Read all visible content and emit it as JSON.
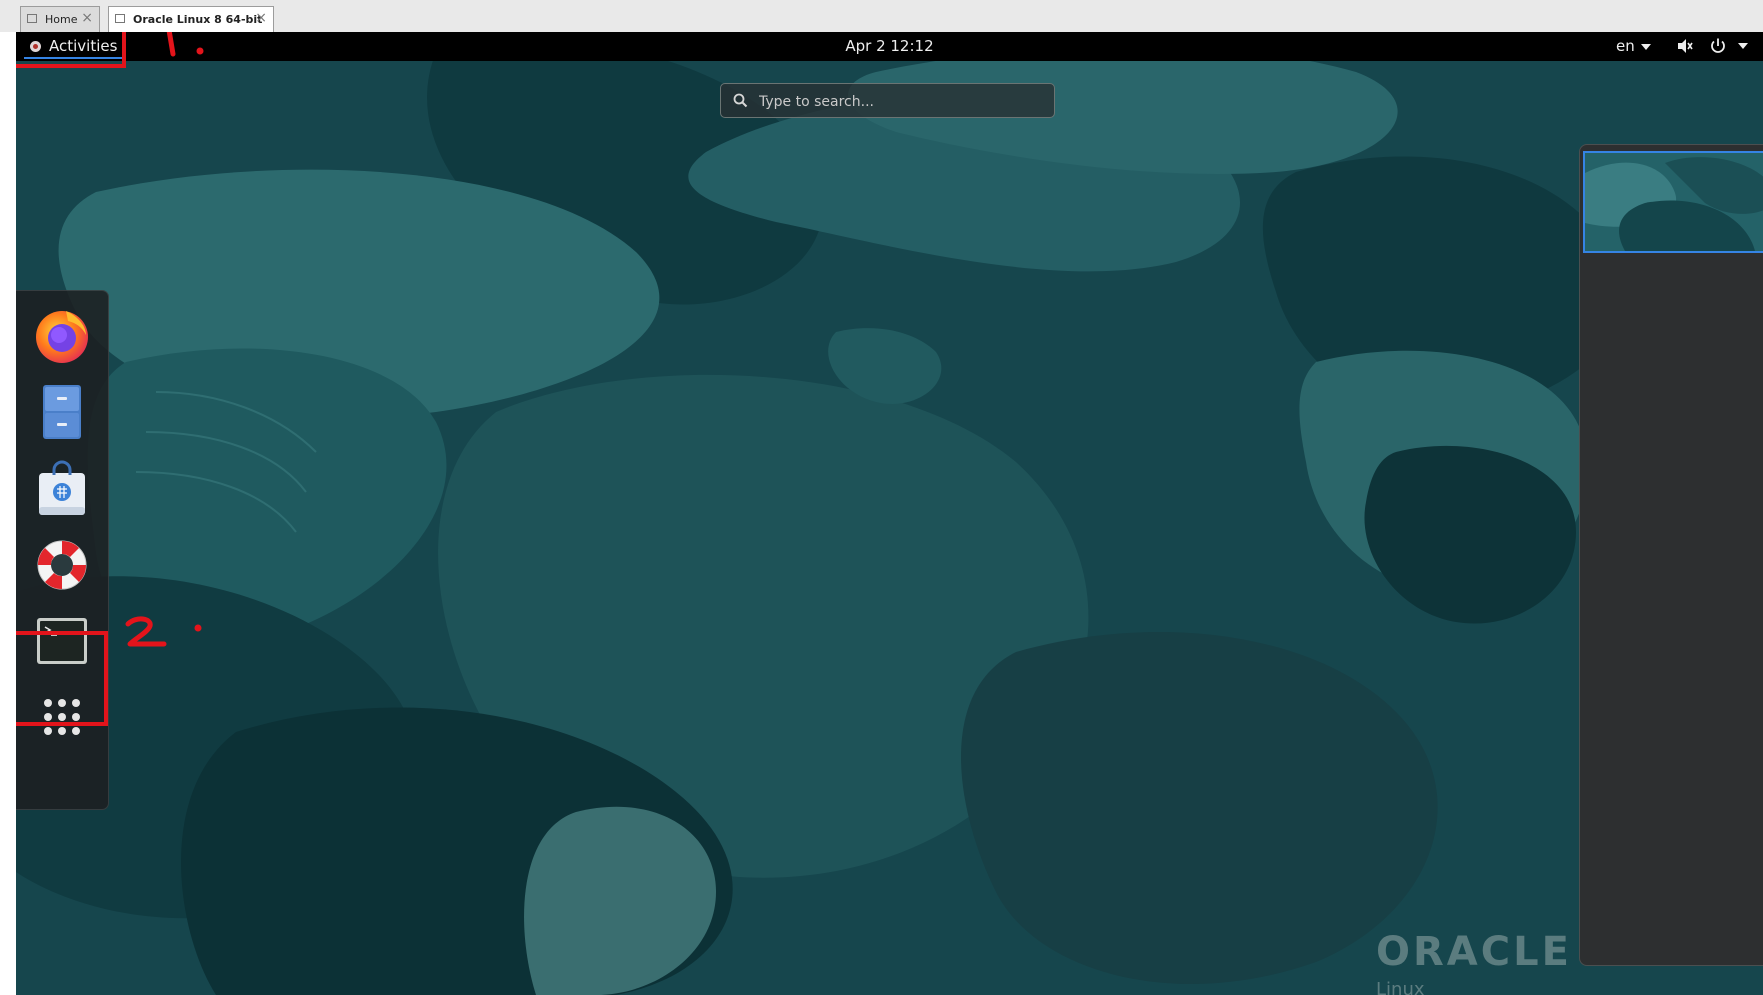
{
  "vm_tabs": [
    {
      "label": "Home",
      "close": "×"
    },
    {
      "label": "Oracle Linux 8 64-bit",
      "close": "×"
    }
  ],
  "topbar": {
    "activities_label": "Activities",
    "clock": "Apr 2  12:12",
    "language": "en"
  },
  "search": {
    "placeholder": "Type to search..."
  },
  "dash": {
    "items": [
      {
        "name": "firefox",
        "icon": "firefox-icon"
      },
      {
        "name": "files",
        "icon": "file-cabinet-icon"
      },
      {
        "name": "software",
        "icon": "shopping-bag-icon"
      },
      {
        "name": "help",
        "icon": "lifebuoy-icon"
      },
      {
        "name": "terminal",
        "icon": "terminal-icon"
      },
      {
        "name": "show-applications",
        "icon": "app-grid-icon"
      }
    ]
  },
  "watermark": {
    "line1": "ORACLE",
    "line2": "Linux"
  },
  "annotations": [
    {
      "mark": "1."
    },
    {
      "mark": "2."
    }
  ],
  "colors": {
    "wallpaper": "#16464d",
    "topbar": "#000000",
    "accent": "#3584e4",
    "annotation": "#e3141b"
  }
}
